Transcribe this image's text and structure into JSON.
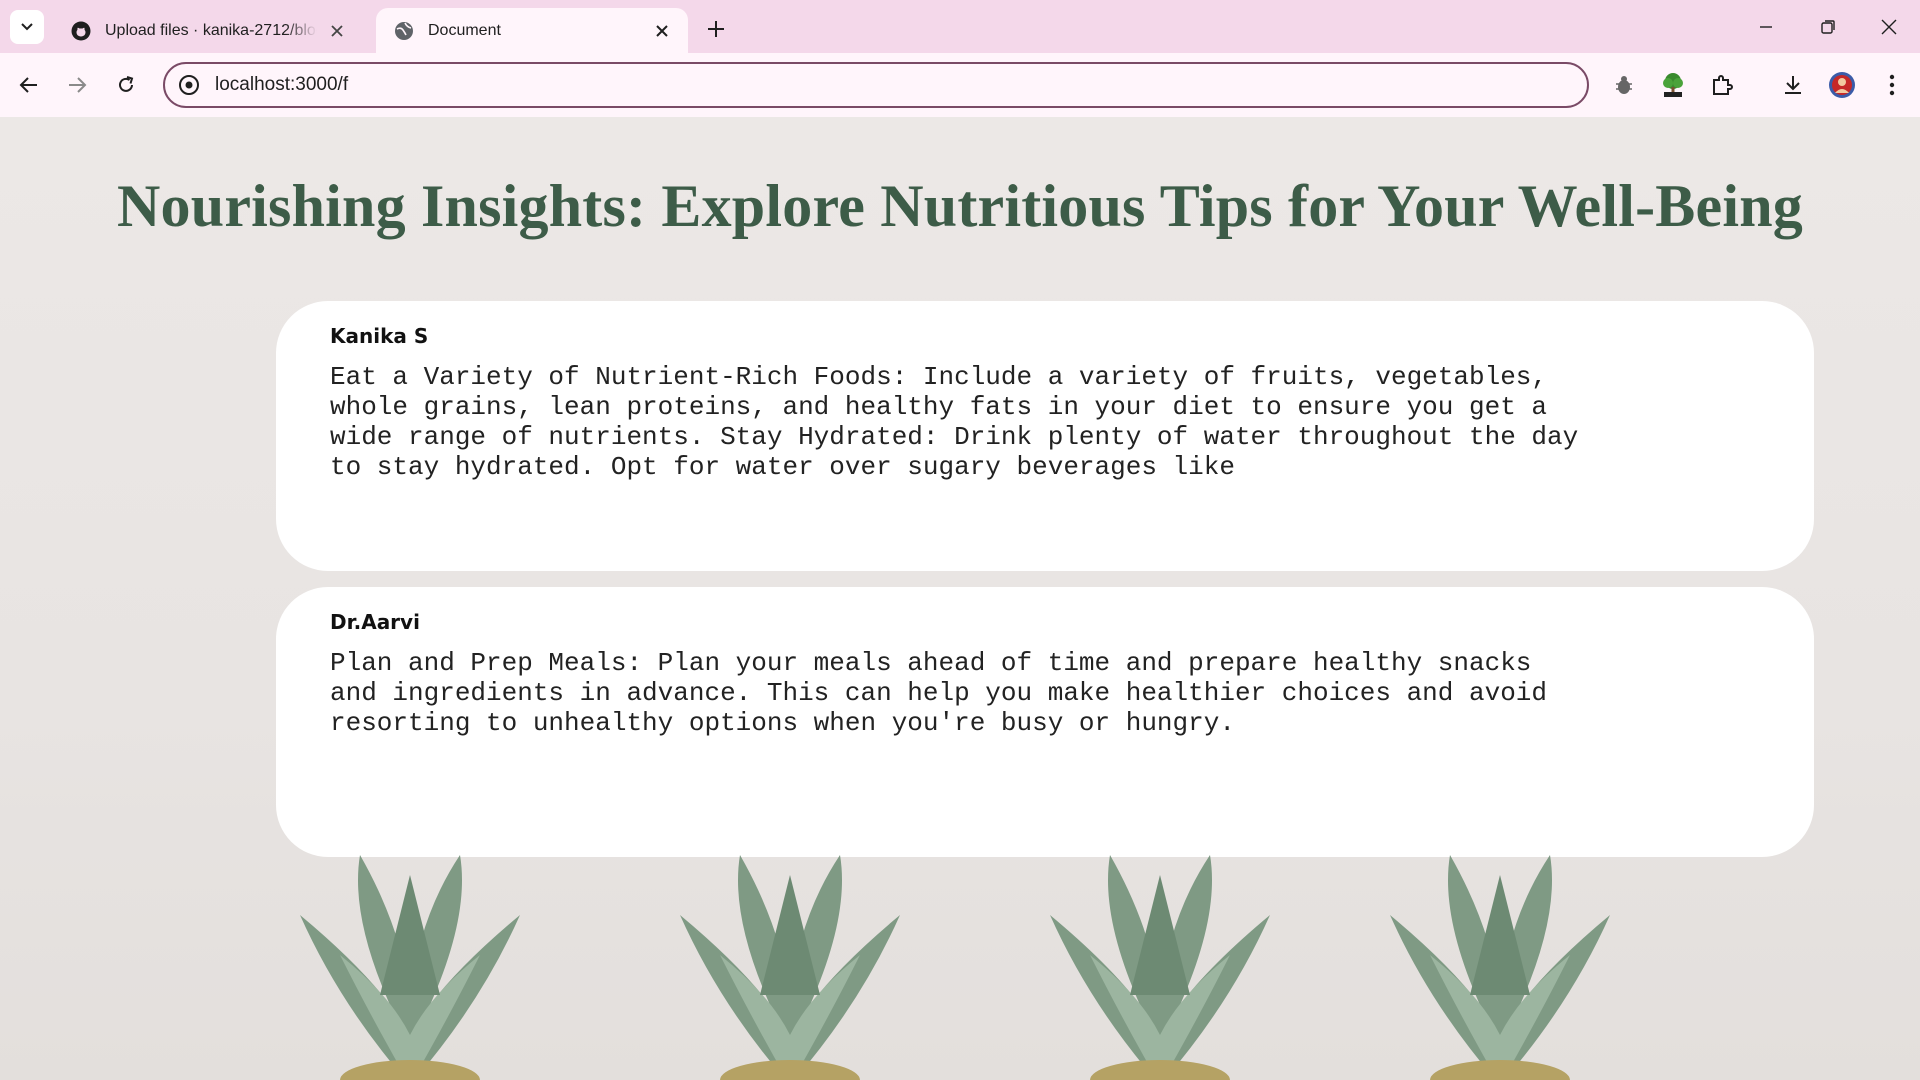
{
  "browser": {
    "tabs": [
      {
        "title": "Upload files · kanika-2712/blog_website",
        "active": false
      },
      {
        "title": "Document",
        "active": true
      }
    ],
    "address": "localhost:3000/f",
    "icons": [
      "tab-search-icon",
      "github-icon",
      "globe-icon",
      "close-icon",
      "plus-icon",
      "minimize-icon",
      "restore-icon",
      "window-close-icon",
      "back-icon",
      "forward-icon",
      "reload-icon",
      "site-info-icon",
      "bug-extension-icon",
      "tree-extension-icon",
      "puzzle-icon",
      "download-icon",
      "avatar",
      "more-menu-icon"
    ]
  },
  "page": {
    "title": "Nourishing Insights: Explore Nutritious Tips for Your Well-Being",
    "posts": [
      {
        "author": "Kanika S",
        "content": "Eat a Variety of Nutrient-Rich Foods: Include a variety of fruits, vegetables, whole grains, lean proteins, and healthy fats in your diet to ensure you get a wide range of nutrients. Stay Hydrated: Drink plenty of water throughout the day to stay hydrated. Opt for water over sugary beverages like"
      },
      {
        "author": "Dr.Aarvi",
        "content": "Plan and Prep Meals: Plan your meals ahead of time and prepare healthy snacks and ingredients in advance. This can help you make healthier choices and avoid resorting to unhealthy options when you're busy or hungry."
      }
    ]
  },
  "colors": {
    "tabstrip": "#f4d8ea",
    "toolbar": "#fff5fb",
    "omnibox_border": "#7a4a66",
    "title": "#3d5c48",
    "card": "#ffffff",
    "page_bg": "#e9e5e3"
  }
}
